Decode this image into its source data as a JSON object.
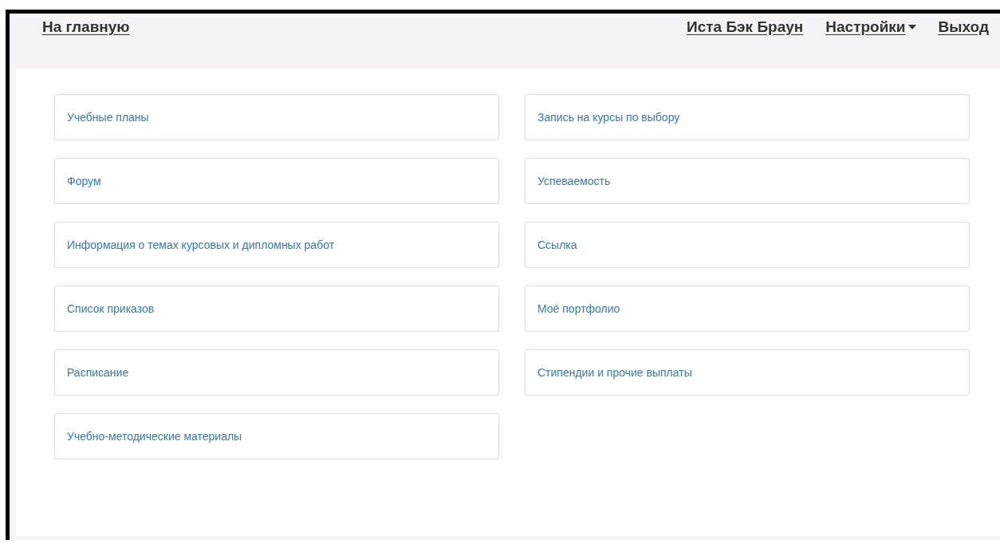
{
  "header": {
    "home_link": "На главную",
    "user_link": "Иста Бэк Браун",
    "settings_menu": "Настройки",
    "logout_link": "Выход"
  },
  "columns": [
    {
      "tiles": [
        "Учебные планы",
        "Форум",
        "Информация о темах курсовых и дипломных работ",
        "Список приказов",
        "Расписание",
        "Учебно-методические материалы"
      ]
    },
    {
      "tiles": [
        "Запись на курсы по выбору",
        "Успеваемость",
        "Ссылка",
        "Моё портфолио",
        "Стипендии и прочие выплаты"
      ]
    }
  ]
}
